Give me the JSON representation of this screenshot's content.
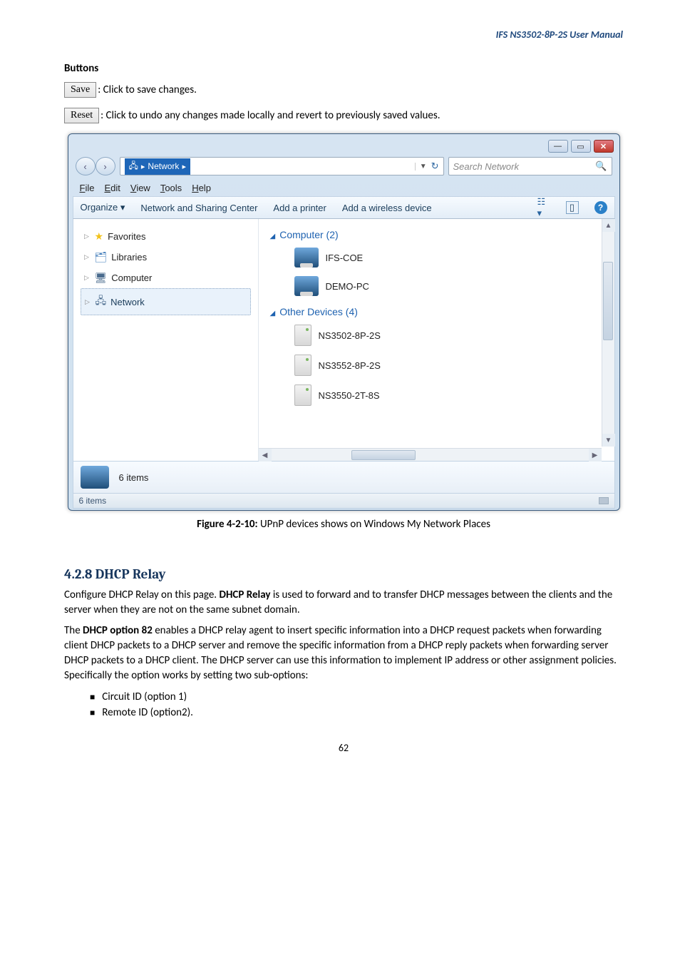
{
  "doc": {
    "header": "IFS NS3502-8P-2S  User  Manual",
    "buttons_heading": "Buttons",
    "save_label": "Save",
    "save_desc": ": Click to save changes.",
    "reset_label": "Reset",
    "reset_desc": ": Click to undo any changes made locally and revert to previously saved values.",
    "figure_caption_bold": "Figure 4-2-10:",
    "figure_caption_rest": " UPnP devices shows on Windows My Network Places",
    "section_heading": "4.2.8 DHCP Relay",
    "para1a": "Configure DHCP Relay on this page. ",
    "para1b": "DHCP Relay",
    "para1c": " is used to forward and to transfer DHCP messages between the clients and the server when they are not on the same subnet domain.",
    "para2a": "The ",
    "para2b": "DHCP option 82",
    "para2c": " enables a DHCP relay agent to insert specific information into a DHCP request packets when forwarding client DHCP packets to a DHCP server and remove the specific information from a DHCP reply packets when forwarding server DHCP packets to a DHCP client. The DHCP server can use this information to implement IP address or other assignment policies. Specifically the option works by setting two sub-options:",
    "bullet1": "Circuit ID (option 1)",
    "bullet2": "Remote ID (option2).",
    "page_number": "62"
  },
  "win": {
    "breadcrumb_network": "Network",
    "search_placeholder": "Search Network",
    "menu": {
      "file": "File",
      "edit": "Edit",
      "view": "View",
      "tools": "Tools",
      "help": "Help"
    },
    "toolbar": {
      "organize": "Organize",
      "nsc": "Network and Sharing Center",
      "add_printer": "Add a printer",
      "add_wireless": "Add a wireless device"
    },
    "side": {
      "favorites": "Favorites",
      "libraries": "Libraries",
      "computer": "Computer",
      "network": "Network"
    },
    "group_computer": "Computer (2)",
    "group_other": "Other Devices (4)",
    "computers": [
      "IFS-COE",
      "DEMO-PC"
    ],
    "devices": [
      "NS3502-8P-2S",
      "NS3552-8P-2S",
      "NS3550-2T-8S"
    ],
    "details_count": "6 items",
    "status_count": "6 items"
  }
}
